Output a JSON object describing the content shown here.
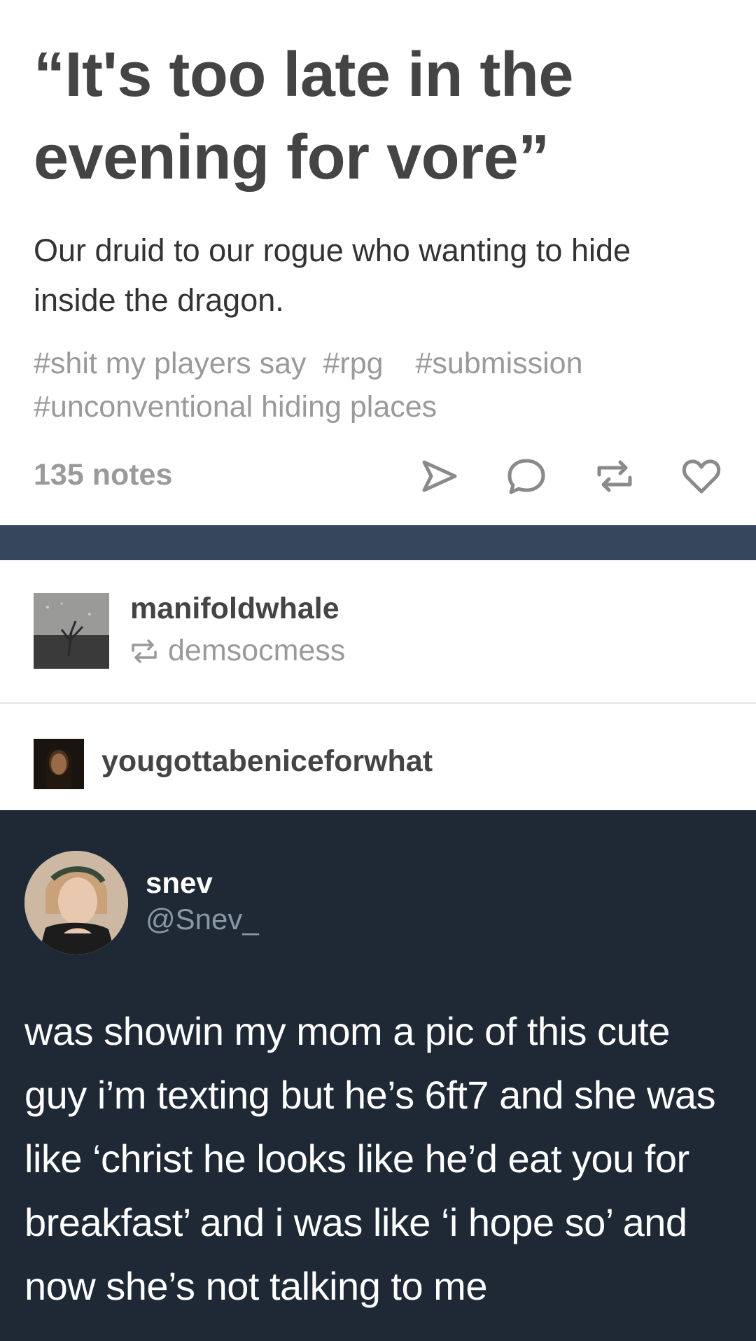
{
  "post": {
    "title": "“It's too late in the evening for vore”",
    "body": "Our druid to our rogue who wanting to hide inside the dragon.",
    "tags": [
      "#shit my players say",
      "#rpg",
      "#submission",
      "#unconventional hiding places"
    ],
    "notes": "135 notes",
    "actions": [
      {
        "name": "share",
        "icon": "send-icon"
      },
      {
        "name": "reply",
        "icon": "comment-icon"
      },
      {
        "name": "reblog",
        "icon": "reblog-icon"
      },
      {
        "name": "like",
        "icon": "heart-icon"
      }
    ]
  },
  "reblog": {
    "username": "manifoldwhale",
    "via_icon": "reblog-icon",
    "via": "demsocmess"
  },
  "trail": {
    "username": "yougottabeniceforwhat"
  },
  "tweet": {
    "name": "snev",
    "handle": "@Snev_",
    "text": "was showin my mom a pic of this cute guy i’m texting but he’s 6ft7 and she was like ‘christ he looks like he’d eat you for breakfast’ and i was like ‘i hope so’ and now she’s not talking to me"
  },
  "colors": {
    "divider": "#36465d",
    "tweet_bg": "#1f2835",
    "meta_gray": "#9a9a9a",
    "title_gray": "#444444"
  }
}
